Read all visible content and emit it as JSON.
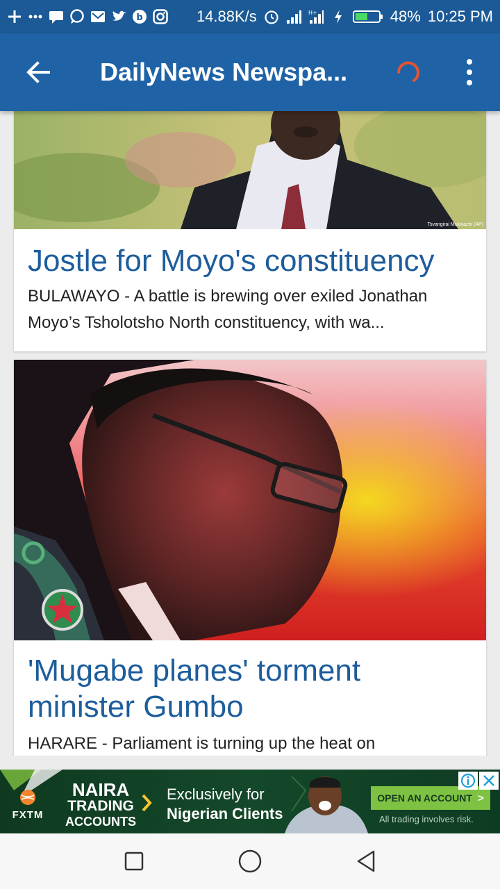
{
  "status_bar": {
    "net_speed": "14.88K/s",
    "battery": "48%",
    "time": "10:25 PM",
    "icons": [
      "plus-icon",
      "more-dots-icon",
      "message-icon",
      "chat-icon",
      "mail-icon",
      "twitter-icon",
      "bbm-icon",
      "instagram-icon",
      "alarm-icon",
      "signal-icon",
      "signal-4g-icon",
      "charging-icon",
      "battery-icon"
    ]
  },
  "app_bar": {
    "title": "DailyNews Newspa...",
    "back_icon": "arrow-left-icon",
    "loading_icon": "spinner-icon",
    "menu_icon": "overflow-menu-icon",
    "accent_color": "#1f63a6",
    "spinner_color": "#e8532f"
  },
  "articles": [
    {
      "title": "Jostle for Moyo's constituency",
      "summary": "BULAWAYO - A battle is brewing over exiled Jonathan Moyo’s Tsholotsho North constituency, with wa...",
      "photo_credit": "Tsvangirai Mukwazhi (AP)"
    },
    {
      "title": "'Mugabe planes' torment minister Gumbo",
      "summary": "HARARE - Parliament is turning up the heat on"
    }
  ],
  "ad": {
    "brand": "FXTM",
    "headline_1": "NAIRA",
    "headline_2": "TRADING",
    "headline_3": "ACCOUNTS",
    "tagline_1": "Exclusively for",
    "tagline_2": "Nigerian Clients",
    "cta": "OPEN AN ACCOUNT",
    "cta_arrow": ">",
    "disclaimer": "All trading involves risk.",
    "info_icon": "info-icon",
    "close_icon": "close-icon"
  },
  "nav_bar": {
    "recents_icon": "square-recents-icon",
    "home_icon": "circle-home-icon",
    "back_icon": "triangle-back-icon"
  }
}
